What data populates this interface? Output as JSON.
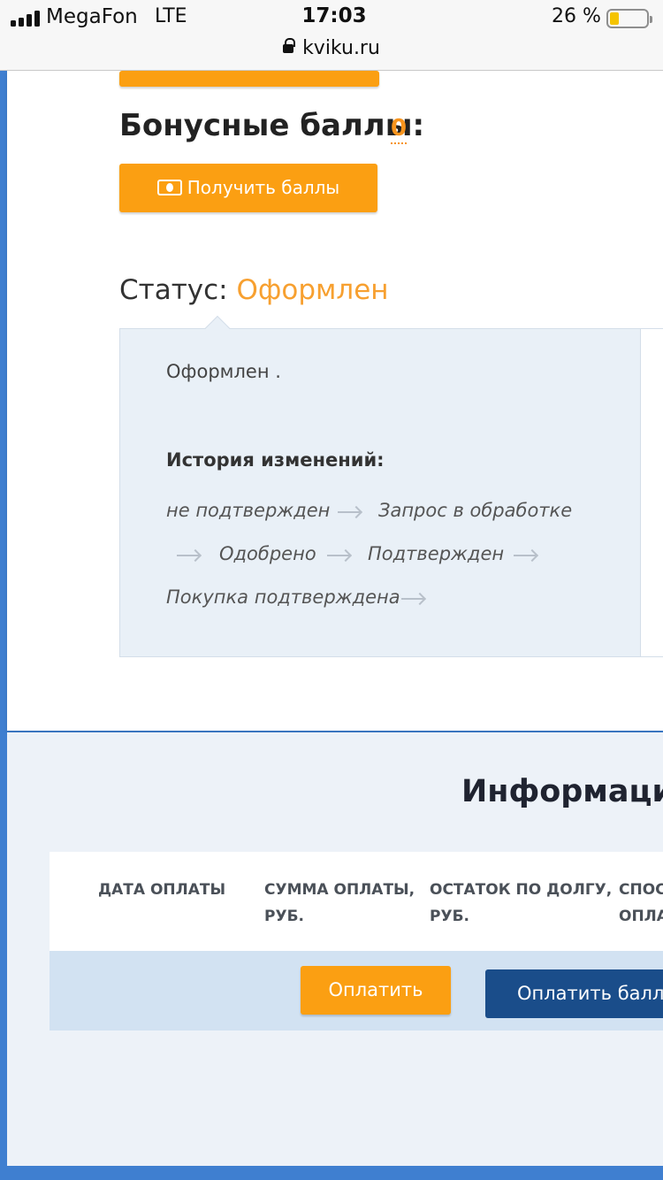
{
  "status_bar": {
    "carrier": "MegaFon",
    "network": "LTE",
    "time": "17:03",
    "battery_percent": "26 %",
    "battery_level": 0.26,
    "url": "kviku.ru"
  },
  "bonus": {
    "title": "Бонусные баллы:",
    "value": "0",
    "get_button_label": "Получить баллы",
    "get_button_icon": "money-icon"
  },
  "status": {
    "label": "Статус:",
    "value": "Оформлен",
    "description": "Оформлен .",
    "history_title": "История изменений:",
    "history": [
      "не подтвержден",
      "Запрос в обработке",
      "Одобрено",
      "Подтвержден",
      "Покупка подтверждена"
    ]
  },
  "info": {
    "title": "Информация",
    "columns": [
      {
        "line1": "ДАТА ОПЛАТЫ",
        "line2": ""
      },
      {
        "line1": "СУММА ОПЛАТЫ,",
        "line2": "РУБ."
      },
      {
        "line1": "ОСТАТОК ПО ДОЛГУ,",
        "line2": "РУБ."
      },
      {
        "line1": "СПОСО",
        "line2": "ОПЛА"
      }
    ],
    "pay_button_label": "Оплатить",
    "pay_points_button_label": "Оплатить балла"
  },
  "colors": {
    "accent_orange": "#fb9f12",
    "status_orange": "#f7a030",
    "primary_blue": "#1a4d8a",
    "frame_blue": "#3f7fd0"
  }
}
